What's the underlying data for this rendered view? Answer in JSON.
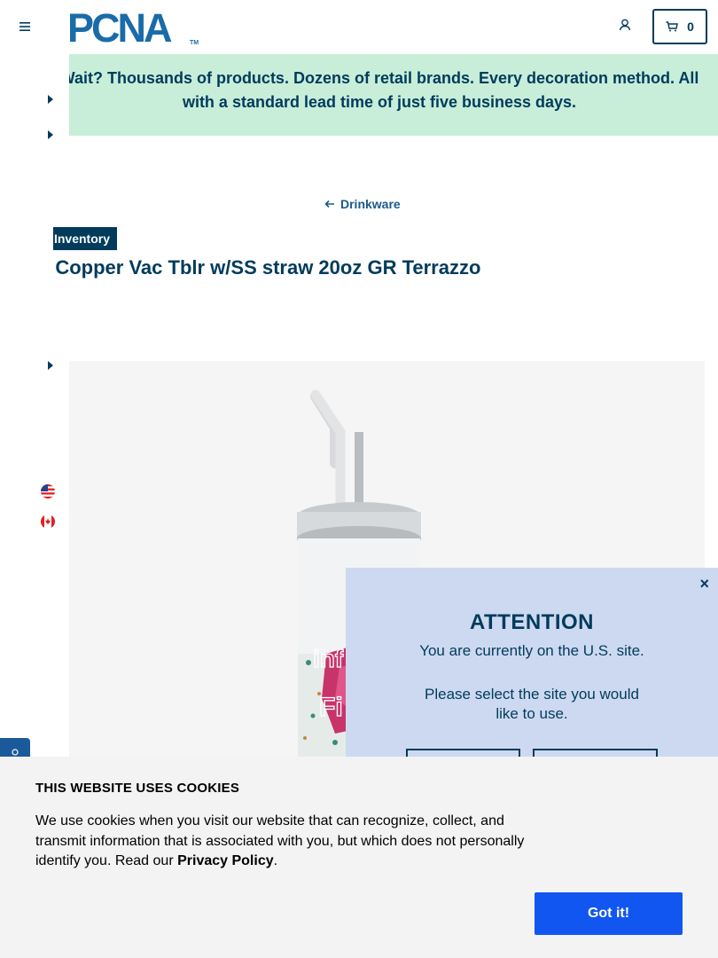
{
  "header": {
    "logo": "PCNA",
    "logo_tm": "TM",
    "cart_count": "0"
  },
  "promo": {
    "text": "Wait? Thousands of products. Dozens of retail brands. Every decoration method. All with a standard lead time of just five business days."
  },
  "breadcrumb": {
    "back_label": "Drinkware"
  },
  "product": {
    "badge": "Inventory",
    "title": "a Copper Vac Tblr w/SS straw 20oz GR Terrazzo",
    "image_alt_text": "inf fi"
  },
  "locale": {
    "flags": [
      "us-flag-icon",
      "canada-flag-icon"
    ]
  },
  "modal": {
    "close": "×",
    "title": "ATTENTION",
    "line1": "You are currently on the U.S. site.",
    "line2": "Please select the site you would",
    "line3": "like to use."
  },
  "cookie": {
    "title": "THIS WEBSITE USES COOKIES",
    "text_before": "We use cookies when you visit our website that can recognize, collect, and transmit information that is associated with you, but which does not personally identify you. Read our ",
    "link": "Privacy Policy",
    "text_after": ".",
    "button": "Got it!"
  },
  "colors": {
    "navy": "#003b5c",
    "brand_blue": "#1a6ca8",
    "promo_bg": "#c8eed9",
    "modal_bg": "#cdd9f0",
    "cookie_btn": "#1156f0"
  }
}
